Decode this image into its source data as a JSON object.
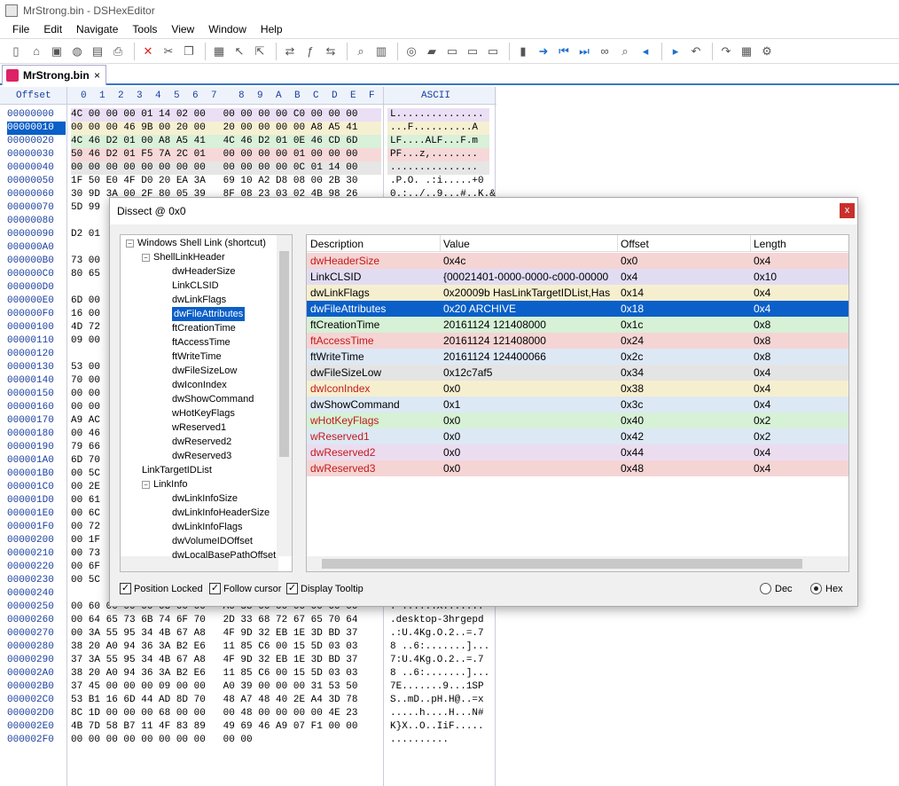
{
  "window": {
    "title": "MrStrong.bin - DSHexEditor"
  },
  "menu": [
    "File",
    "Edit",
    "Navigate",
    "Tools",
    "View",
    "Window",
    "Help"
  ],
  "toolbar_icons": [
    "new-file-icon",
    "open-icon",
    "save-icon",
    "globe-icon",
    "save-as-icon",
    "print-icon",
    "close-icon",
    "cut-icon",
    "copy-icon",
    "paste-icon",
    "select-icon",
    "select-range-icon",
    "compare-icon",
    "function-icon",
    "replace-icon",
    "find-icon",
    "dissect-icon",
    "zoom-icon",
    "book-icon",
    "page-icon",
    "page2-icon",
    "page3-icon",
    "bookmark-icon",
    "go-icon",
    "first-icon",
    "last-icon",
    "binoculars-icon",
    "find-next-icon",
    "prev-mark-icon",
    "next-mark-icon",
    "undo-icon",
    "redo-icon",
    "calculator-icon",
    "settings-icon"
  ],
  "tab": {
    "label": "MrStrong.bin",
    "close": "×"
  },
  "hex": {
    "offset_header": "Offset",
    "col_headers": [
      "0",
      "1",
      "2",
      "3",
      "4",
      "5",
      "6",
      "7",
      "8",
      "9",
      "A",
      "B",
      "C",
      "D",
      "E",
      "F"
    ],
    "ascii_header": "ASCII",
    "offsets": [
      "00000000",
      "00000010",
      "00000020",
      "00000030",
      "00000040",
      "00000050",
      "00000060",
      "00000070",
      "00000080",
      "00000090",
      "000000A0",
      "000000B0",
      "000000C0",
      "000000D0",
      "000000E0",
      "000000F0",
      "00000100",
      "00000110",
      "00000120",
      "00000130",
      "00000140",
      "00000150",
      "00000160",
      "00000170",
      "00000180",
      "00000190",
      "000001A0",
      "000001B0",
      "000001C0",
      "000001D0",
      "000001E0",
      "000001F0",
      "00000200",
      "00000210",
      "00000220",
      "00000230",
      "00000240",
      "00000250",
      "00000260",
      "00000270",
      "00000280",
      "00000290",
      "000002A0",
      "000002B0",
      "000002C0",
      "000002D0",
      "000002E0",
      "000002F0"
    ],
    "rows_full": [
      {
        "hex": "4C 00 00 00 01 14 02 00   00 00 00 00 C0 00 00 00",
        "ascii": "L..............."
      },
      {
        "hex": "00 00 00 46 9B 00 20 00   20 00 00 00 00 A8 A5 41",
        "ascii": "...F..........A"
      },
      {
        "hex": "4C 46 D2 01 00 A8 A5 41   4C 46 D2 01 0E 46 CD 6D",
        "ascii": "LF....ALF...F.m"
      },
      {
        "hex": "50 46 D2 01 F5 7A 2C 01   00 00 00 00 01 00 00 00",
        "ascii": "PF...z,........"
      },
      {
        "hex": "00 00 00 00 00 00 00 00   00 00 00 00 0C 01 14 00",
        "ascii": "..............."
      },
      {
        "hex": "1F 50 E0 4F D0 20 EA 3A   69 10 A2 D8 08 00 2B 30",
        "ascii": ".P.O. .:i.....+0"
      },
      {
        "hex": "30 9D 3A 00 2F 80 05 39   8F 08 23 03 02 4B 98 26",
        "ascii": "0.:../..9...#..K.&"
      }
    ],
    "rows_partial": [
      "5D 99",
      "",
      "D2 01",
      "",
      "73 00",
      "80 65",
      "",
      "6D 00",
      "16 00",
      "4D 72",
      "09 00",
      "",
      "53 00",
      "70 00",
      "00 00",
      "00 00",
      "A9 AC",
      "00 46",
      "79 66",
      "6D 70",
      "00 5C",
      "00 2E",
      "00 61",
      "00 6C",
      "00 72",
      "00 1F",
      "00 73",
      "00 6F",
      "00 5C"
    ],
    "rows_bottom": [
      {
        "hex": "00 60 00 00 00 03 00 00   A0 58 00 00 00 00 00 00",
        "ascii": ".`......X......."
      },
      {
        "hex": "00 64 65 73 6B 74 6F 70   2D 33 68 72 67 65 70 64",
        "ascii": ".desktop-3hrgepd"
      },
      {
        "hex": "00 3A 55 95 34 4B 67 A8   4F 9D 32 EB 1E 3D BD 37",
        "ascii": ".:U.4Kg.O.2..=.7"
      },
      {
        "hex": "38 20 A0 94 36 3A B2 E6   11 85 C6 00 15 5D 03 03",
        "ascii": "8 ..6:.......]..."
      },
      {
        "hex": "37 3A 55 95 34 4B 67 A8   4F 9D 32 EB 1E 3D BD 37",
        "ascii": "7:U.4Kg.O.2..=.7"
      },
      {
        "hex": "38 20 A0 94 36 3A B2 E6   11 85 C6 00 15 5D 03 03",
        "ascii": "8 ..6:.......]..."
      },
      {
        "hex": "37 45 00 00 00 09 00 00   A0 39 00 00 00 31 53 50",
        "ascii": "7E.......9...1SP"
      },
      {
        "hex": "53 B1 16 6D 44 AD 8D 70   48 A7 48 40 2E A4 3D 78",
        "ascii": "S..mD..pH.H@..=x"
      },
      {
        "hex": "8C 1D 00 00 00 68 00 00   00 48 00 00 00 00 4E 23",
        "ascii": ".....h....H...N#"
      },
      {
        "hex": "4B 7D 58 B7 11 4F 83 89   49 69 46 A9 07 F1 00 00",
        "ascii": "K}X..O..IiF....."
      },
      {
        "hex": "00 00 00 00 00 00 00 00   00 00",
        "ascii": ".........."
      }
    ]
  },
  "dissect": {
    "title": "Dissect @ 0x0",
    "close": "x",
    "tree": [
      {
        "label": "Windows Shell Link (shortcut)",
        "level": 0,
        "exp": "−"
      },
      {
        "label": "ShellLinkHeader",
        "level": 1,
        "exp": "−"
      },
      {
        "label": "dwHeaderSize",
        "level": 2
      },
      {
        "label": "LinkCLSID",
        "level": 2
      },
      {
        "label": "dwLinkFlags",
        "level": 2
      },
      {
        "label": "dwFileAttributes",
        "level": 2,
        "selected": true
      },
      {
        "label": "ftCreationTime",
        "level": 2
      },
      {
        "label": "ftAccessTime",
        "level": 2
      },
      {
        "label": "ftWriteTime",
        "level": 2
      },
      {
        "label": "dwFileSizeLow",
        "level": 2
      },
      {
        "label": "dwIconIndex",
        "level": 2
      },
      {
        "label": "dwShowCommand",
        "level": 2
      },
      {
        "label": "wHotKeyFlags",
        "level": 2
      },
      {
        "label": "wReserved1",
        "level": 2
      },
      {
        "label": "dwReserved2",
        "level": 2
      },
      {
        "label": "dwReserved3",
        "level": 2
      },
      {
        "label": "LinkTargetIDList",
        "level": 1
      },
      {
        "label": "LinkInfo",
        "level": 1,
        "exp": "−"
      },
      {
        "label": "dwLinkInfoSize",
        "level": 2
      },
      {
        "label": "dwLinkInfoHeaderSize",
        "level": 2
      },
      {
        "label": "dwLinkInfoFlags",
        "level": 2
      },
      {
        "label": "dwVolumeIDOffset",
        "level": 2
      },
      {
        "label": "dwLocalBasePathOffset",
        "level": 2
      }
    ],
    "columns": [
      "Description",
      "Value",
      "Offset",
      "Length"
    ],
    "rows": [
      {
        "desc": "dwHeaderSize",
        "value": "0x4c",
        "offset": "0x0",
        "length": "0x4",
        "color": "#f5d4d4",
        "red": true
      },
      {
        "desc": "LinkCLSID",
        "value": "{00021401-0000-0000-c000-00000",
        "offset": "0x4",
        "length": "0x10",
        "color": "#e2dcf3",
        "red": false
      },
      {
        "desc": "dwLinkFlags",
        "value": "0x20009b HasLinkTargetIDList,Has",
        "offset": "0x14",
        "length": "0x4",
        "color": "#f6efcf",
        "red": false
      },
      {
        "desc": "dwFileAttributes",
        "value": "0x20 ARCHIVE",
        "offset": "0x18",
        "length": "0x4",
        "color": "#0a5fc8",
        "red": false,
        "selected": true
      },
      {
        "desc": "ftCreationTime",
        "value": "20161124 121408000",
        "offset": "0x1c",
        "length": "0x8",
        "color": "#d6f1d6",
        "red": false
      },
      {
        "desc": "ftAccessTime",
        "value": "20161124 121408000",
        "offset": "0x24",
        "length": "0x8",
        "color": "#f5d4d4",
        "red": true
      },
      {
        "desc": "ftWriteTime",
        "value": "20161124 124400066",
        "offset": "0x2c",
        "length": "0x8",
        "color": "#dde8f5",
        "red": false
      },
      {
        "desc": "dwFileSizeLow",
        "value": "0x12c7af5",
        "offset": "0x34",
        "length": "0x4",
        "color": "#e4e4e4",
        "red": false
      },
      {
        "desc": "dwIconIndex",
        "value": "0x0",
        "offset": "0x38",
        "length": "0x4",
        "color": "#f6efcf",
        "red": true
      },
      {
        "desc": "dwShowCommand",
        "value": "0x1",
        "offset": "0x3c",
        "length": "0x4",
        "color": "#dde8f5",
        "red": false
      },
      {
        "desc": "wHotKeyFlags",
        "value": "0x0",
        "offset": "0x40",
        "length": "0x2",
        "color": "#d6f1d6",
        "red": true
      },
      {
        "desc": "wReserved1",
        "value": "0x0",
        "offset": "0x42",
        "length": "0x2",
        "color": "#dde8f5",
        "red": true
      },
      {
        "desc": "dwReserved2",
        "value": "0x0",
        "offset": "0x44",
        "length": "0x4",
        "color": "#ecdcf0",
        "red": true
      },
      {
        "desc": "dwReserved3",
        "value": "0x0",
        "offset": "0x48",
        "length": "0x4",
        "color": "#f5d4d4",
        "red": true
      }
    ],
    "options": {
      "position_locked": "Position Locked",
      "follow_cursor": "Follow cursor",
      "display_tooltip": "Display Tooltip",
      "dec": "Dec",
      "hex": "Hex",
      "selected_radix": "Hex"
    }
  }
}
